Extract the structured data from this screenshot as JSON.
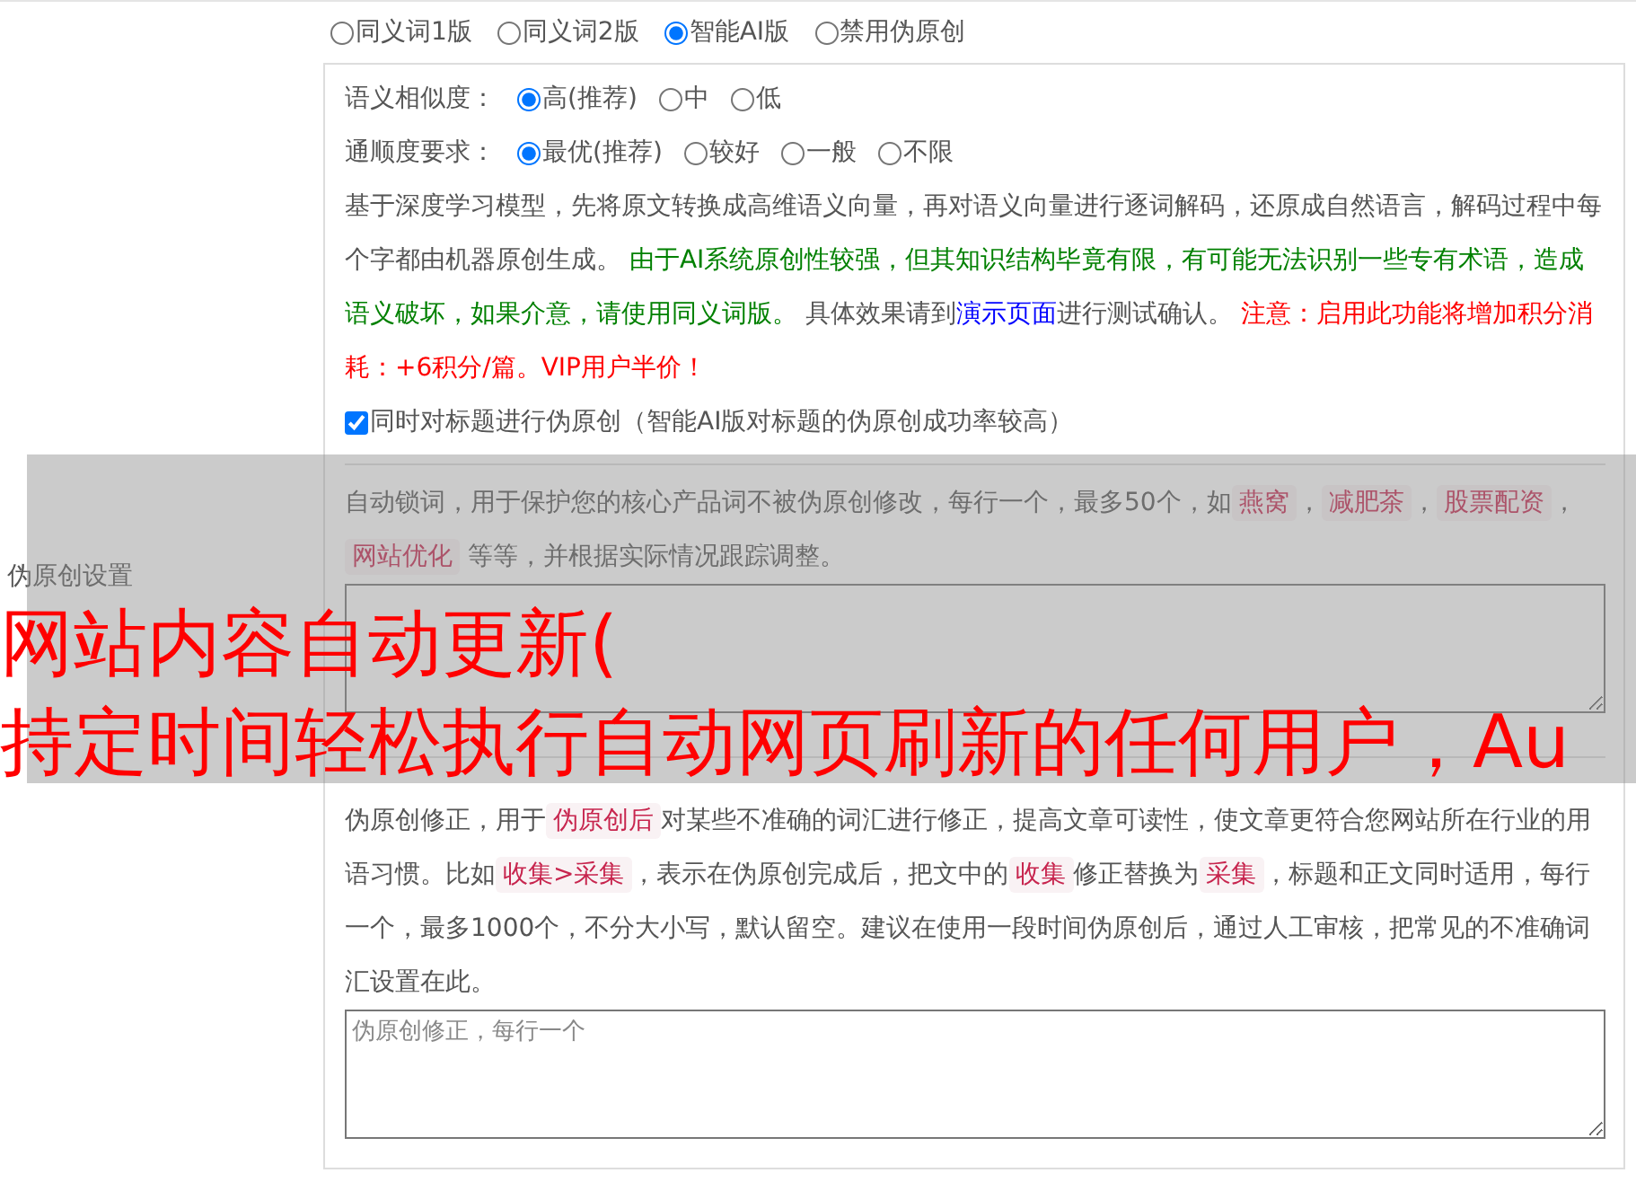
{
  "mode_options": [
    {
      "label": "同义词1版",
      "selected": false
    },
    {
      "label": "同义词2版",
      "selected": false
    },
    {
      "label": "智能AI版",
      "selected": true
    },
    {
      "label": "禁用伪原创",
      "selected": false
    }
  ],
  "section_label": "伪原创设置",
  "similarity": {
    "label": "语义相似度：",
    "options": [
      {
        "label": "高(推荐)",
        "selected": true
      },
      {
        "label": "中",
        "selected": false
      },
      {
        "label": "低",
        "selected": false
      }
    ]
  },
  "fluency": {
    "label": "通顺度要求：",
    "options": [
      {
        "label": "最优(推荐)",
        "selected": true
      },
      {
        "label": "较好",
        "selected": false
      },
      {
        "label": "一般",
        "selected": false
      },
      {
        "label": "不限",
        "selected": false
      }
    ]
  },
  "description": [
    {
      "kind": "text",
      "text": "基于深度学习模型，先将原文转换成高维语义向量，再对语义向量进行逐词解码，还原成自然语言，解码过程中每个字都由机器原创生成。 "
    },
    {
      "kind": "green",
      "text": "由于AI系统原创性较强，但其知识结构毕竟有限，有可能无法识别一些专有术语，造成语义破坏，如果介意，请使用同义词版。"
    },
    {
      "kind": "text",
      "text": " 具体效果请到"
    },
    {
      "kind": "link",
      "text": "演示页面"
    },
    {
      "kind": "text",
      "text": "进行测试确认。 "
    },
    {
      "kind": "red",
      "text": "注意：启用此功能将增加积分消耗：+6积分/篇。VIP用户半价！"
    }
  ],
  "title_option": {
    "label": "同时对标题进行伪原创（智能AI版对标题的伪原创成功率较高）",
    "checked": true
  },
  "lock_words": {
    "description": [
      {
        "kind": "text",
        "text": "自动锁词，用于保护您的核心产品词不被伪原创修改，每行一个，最多50个，如"
      },
      {
        "kind": "code",
        "text": "燕窝"
      },
      {
        "kind": "text",
        "text": "，"
      },
      {
        "kind": "code",
        "text": "减肥茶"
      },
      {
        "kind": "text",
        "text": "，"
      },
      {
        "kind": "code",
        "text": "股票配资"
      },
      {
        "kind": "text",
        "text": "，"
      },
      {
        "kind": "code",
        "text": "网站优化"
      },
      {
        "kind": "text",
        "text": " 等等，并根据实际情况跟踪调整。"
      }
    ]
  },
  "corrections": {
    "description": [
      {
        "kind": "text",
        "text": "伪原创修正，用于"
      },
      {
        "kind": "code",
        "text": "伪原创后"
      },
      {
        "kind": "text",
        "text": "对某些不准确的词汇进行修正，提高文章可读性，使文章更符合您网站所在行业的用语习惯。比如"
      },
      {
        "kind": "code",
        "text": "收集>采集"
      },
      {
        "kind": "text",
        "text": "，表示在伪原创完成后，把文中的"
      },
      {
        "kind": "code",
        "text": "收集"
      },
      {
        "kind": "text",
        "text": "修正替换为"
      },
      {
        "kind": "code",
        "text": "采集"
      },
      {
        "kind": "text",
        "text": "，标题和正文同时适用，每行一个，最多1000个，不分大小写，默认留空。建议在使用一段时间伪原创后，通过人工审核，把常见的不准确词汇设置在此。"
      }
    ],
    "placeholder": "伪原创修正，每行一个"
  },
  "overlay": {
    "lines": [
      "网站内容自动更新(",
      "持定时间轻松执行自动网页刷新的任何用户，Au"
    ]
  }
}
